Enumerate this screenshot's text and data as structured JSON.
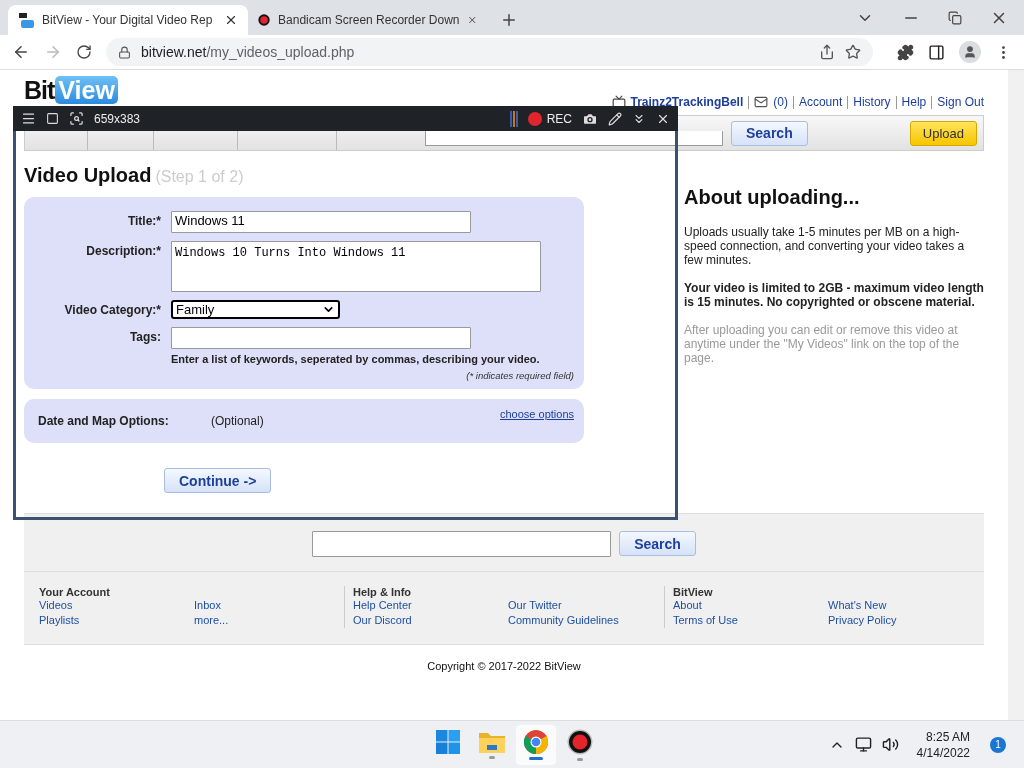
{
  "browser": {
    "tabs": [
      {
        "title": "BitView - Your Digital Video Rep",
        "selected": true,
        "kind": "bitview"
      },
      {
        "title": "Bandicam Screen Recorder Down",
        "selected": false,
        "kind": "recorder"
      }
    ],
    "url": {
      "host": "bitview.net",
      "path": "/my_videos_upload.php"
    }
  },
  "header": {
    "logo": {
      "first": "Bit",
      "second": "View"
    },
    "user": "Trainz2TrackingBell",
    "inbox_count": "(0)",
    "links": [
      "Account",
      "History",
      "Help",
      "Sign Out"
    ]
  },
  "nav": {
    "search_button": "Search",
    "upload_button": "Upload"
  },
  "upload": {
    "heading": "Video Upload",
    "step": "(Step 1 of 2)",
    "fields": [
      {
        "label": "Title:*",
        "kind": "text",
        "value": "Windows 11",
        "focused": false
      },
      {
        "label": "Description:*",
        "kind": "textarea",
        "value": "Windows 10 Turns Into Windows 11",
        "focused": false
      },
      {
        "label": "Video Category:*",
        "kind": "select",
        "value": "Family",
        "focused": true
      },
      {
        "label": "Tags:",
        "kind": "text",
        "focused": false
      }
    ],
    "tags_hint": "Enter a list of keywords, seperated by commas, describing your video.",
    "required_note": "(* indicates required field)",
    "date_options": {
      "label": "Date and Map Options:",
      "note": "(Optional)",
      "link": "choose options"
    },
    "continue_button": "Continue ->"
  },
  "about": {
    "heading": "About uploading...",
    "paragraphs": [
      {
        "kind": "normal",
        "text": "Uploads usually take 1-5 minutes per MB on a high-speed connection, and converting your video takes a few minutes."
      },
      {
        "kind": "bold",
        "text": "Your video is limited to 2GB - maximum video length is 15 minutes. No copyrighted or obscene material."
      },
      {
        "kind": "muted",
        "text": "After uploading you can edit or remove this video at anytime under the \"My Videos\" link on the top of the page."
      }
    ]
  },
  "footer": {
    "search_button": "Search",
    "sections": [
      {
        "heading": "Your Account",
        "columns": [
          [
            "Videos",
            "Playlists"
          ],
          [
            "Inbox",
            "more..."
          ]
        ]
      },
      {
        "heading": "Help & Info",
        "columns": [
          [
            "Help Center",
            "Our Discord"
          ],
          [
            "Our Twitter",
            "Community Guidelines"
          ]
        ]
      },
      {
        "heading": "BitView",
        "columns": [
          [
            "About",
            "Terms of Use"
          ],
          [
            "What's New",
            "Privacy Policy"
          ]
        ]
      }
    ],
    "copyright": "Copyright © 2017-2022 BitView"
  },
  "recorder": {
    "size": "659x383",
    "rec": "REC"
  },
  "taskbar": {
    "apps": [
      {
        "kind": "start",
        "selected": false
      },
      {
        "kind": "explorer",
        "selected": false
      },
      {
        "kind": "chrome",
        "selected": true
      },
      {
        "kind": "recorder",
        "selected": false
      }
    ],
    "time": "8:25 AM",
    "date": "4/14/2022",
    "notifications": "1"
  }
}
